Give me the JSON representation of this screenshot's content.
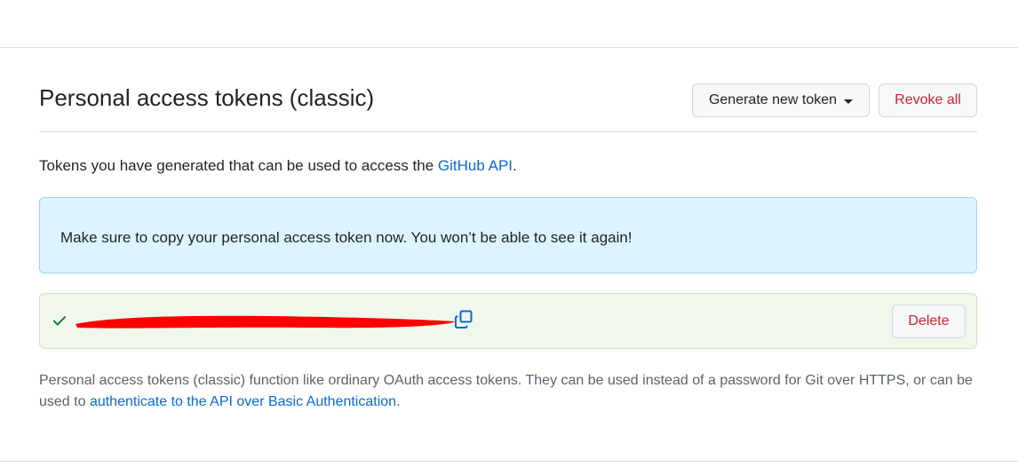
{
  "header": {
    "title": "Personal access tokens (classic)",
    "generate_label": "Generate new token",
    "revoke_label": "Revoke all"
  },
  "intro": {
    "text": "Tokens you have generated that can be used to access the ",
    "link": "GitHub API",
    "suffix": "."
  },
  "flash": {
    "message": "Make sure to copy your personal access token now. You won’t be able to see it again!"
  },
  "token": {
    "value": "",
    "delete_label": "Delete",
    "redacted": true
  },
  "note": {
    "text": "Personal access tokens (classic) function like ordinary OAuth access tokens. They can be used instead of a password for Git over HTTPS, or can be used to ",
    "link": "authenticate to the API over Basic Authentication",
    "suffix": "."
  },
  "colors": {
    "accent_link": "#0969da",
    "danger": "#cf222e",
    "success": "#1a7f37",
    "flash_bg": "#ddf4ff",
    "token_bg": "#f0f8ec",
    "redaction": "#ff0000"
  },
  "icons": {
    "check": "check-icon",
    "copy": "copy-icon",
    "caret": "caret-down-icon"
  }
}
